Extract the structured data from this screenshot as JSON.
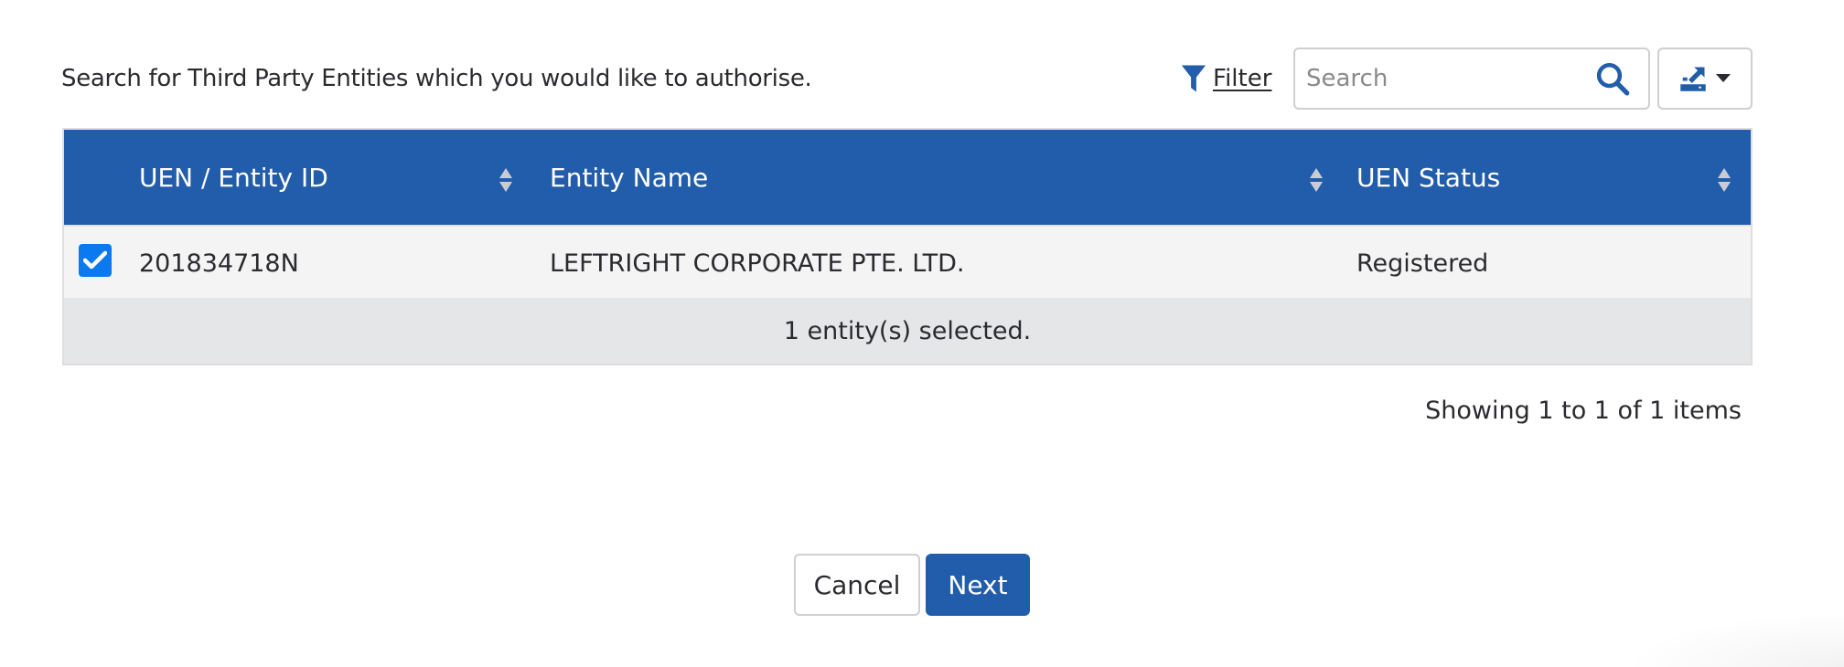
{
  "intro": {
    "text": "Search for Third Party Entities which you would like to authorise."
  },
  "toolbar": {
    "filter_label": "Filter",
    "filter_icon": "funnel-icon",
    "search_placeholder": "Search",
    "search_value": "",
    "search_icon": "magnifier-icon",
    "export_icon": "export-icon",
    "export_caret_icon": "caret-down-icon"
  },
  "table": {
    "columns": [
      {
        "label": "UEN / Entity ID",
        "sortable": true
      },
      {
        "label": "Entity Name",
        "sortable": true
      },
      {
        "label": "UEN Status",
        "sortable": true
      }
    ],
    "rows": [
      {
        "selected": true,
        "uen": "201834718N",
        "entity_name": "LEFTRIGHT CORPORATE PTE. LTD.",
        "status": "Registered"
      }
    ],
    "selection_summary": "1 entity(s) selected."
  },
  "pagination": {
    "info": "Showing 1 to 1 of 1 items"
  },
  "actions": {
    "cancel_label": "Cancel",
    "next_label": "Next"
  },
  "colors": {
    "primary": "#225dab",
    "checkbox": "#0b79f0",
    "row_bg": "#f4f4f4",
    "footer_bg": "#e5e6e8"
  }
}
